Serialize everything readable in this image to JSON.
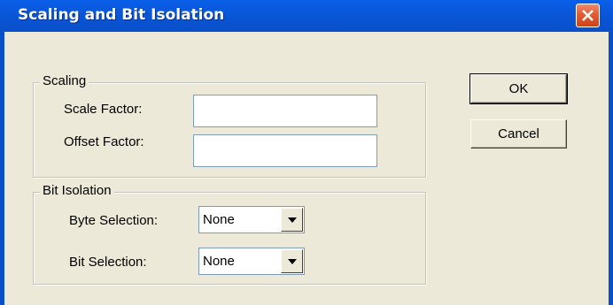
{
  "window": {
    "title": "Scaling and Bit Isolation"
  },
  "scaling": {
    "legend": "Scaling",
    "scale_factor_label": "Scale Factor:",
    "scale_factor_value": "",
    "offset_factor_label": "Offset Factor:",
    "offset_factor_value": ""
  },
  "bit_isolation": {
    "legend": "Bit Isolation",
    "byte_selection_label": "Byte Selection:",
    "byte_selection_value": "None",
    "bit_selection_label": "Bit Selection:",
    "bit_selection_value": "None"
  },
  "buttons": {
    "ok_label": "OK",
    "cancel_label": "Cancel"
  },
  "icons": {
    "close": "close-icon",
    "dropdown": "chevron-down-icon"
  },
  "colors": {
    "titlebar": "#0a58dc",
    "dialog_background": "#ece9d8",
    "close_button": "#e25c34"
  }
}
